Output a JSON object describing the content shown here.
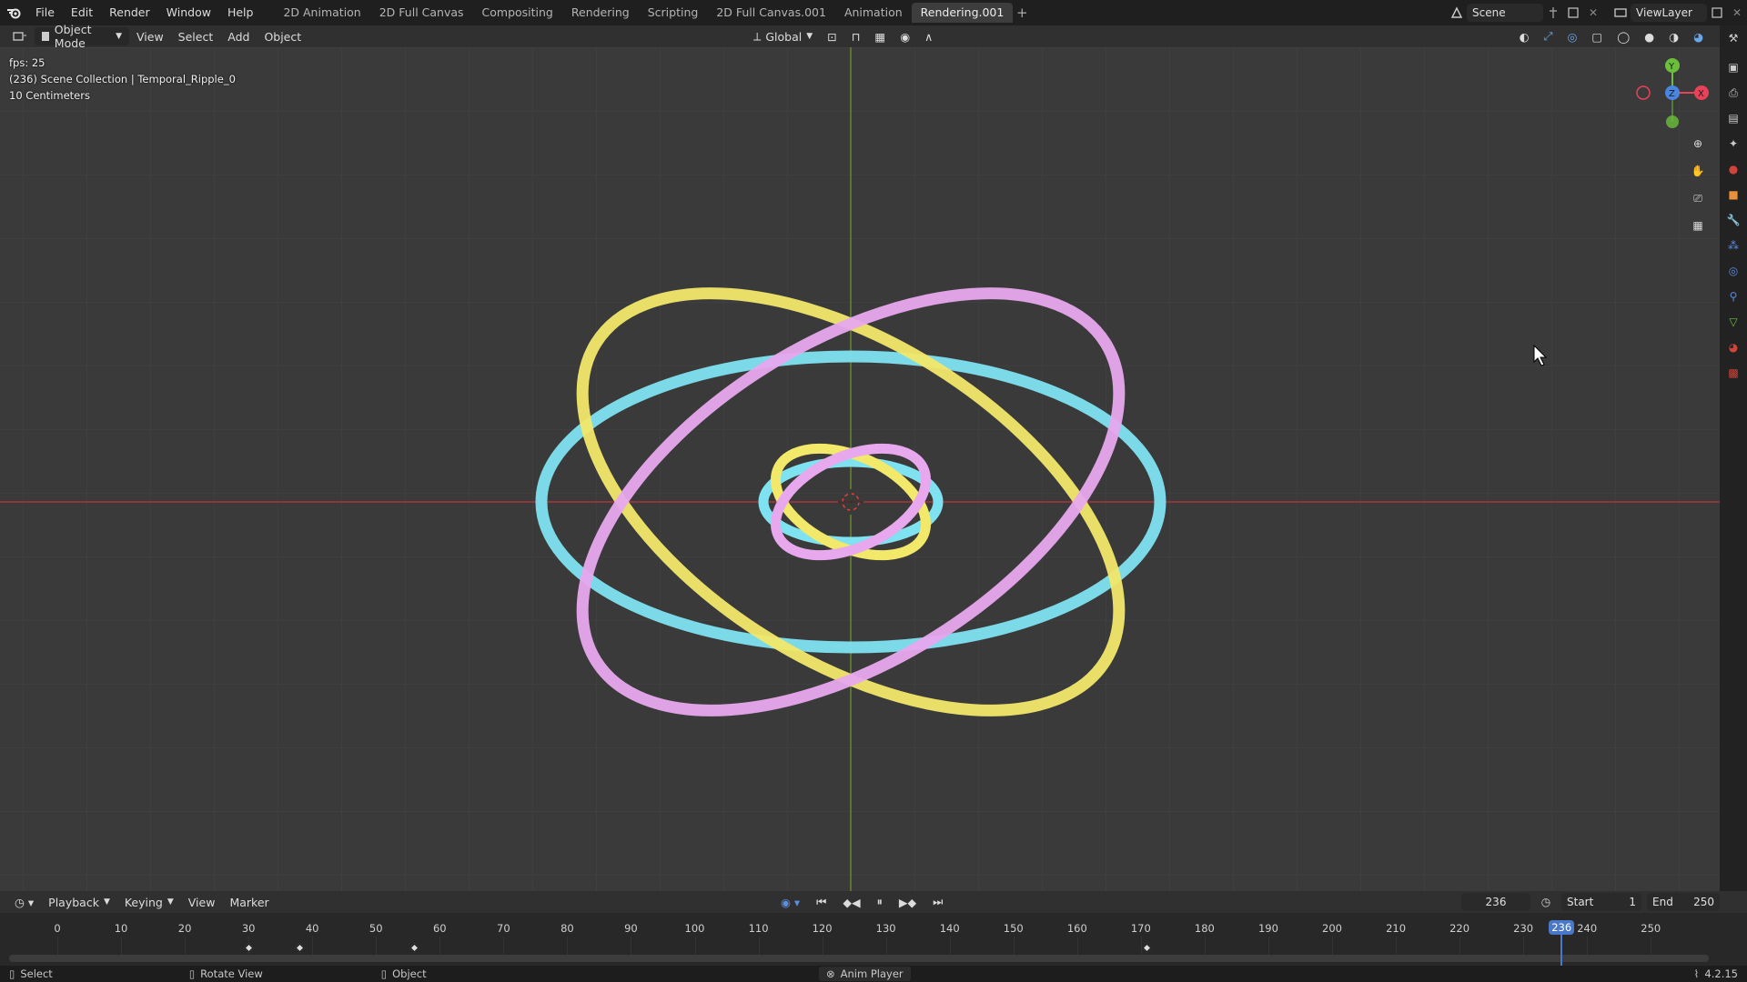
{
  "topbar": {
    "menu": [
      "File",
      "Edit",
      "Render",
      "Window",
      "Help"
    ],
    "tabs": [
      "2D Animation",
      "2D Full Canvas",
      "Compositing",
      "Rendering",
      "Scripting",
      "2D Full Canvas.001",
      "Animation",
      "Rendering.001"
    ],
    "active_tab": "Rendering.001",
    "scene": "Scene",
    "view_layer": "ViewLayer"
  },
  "header": {
    "mode": "Object Mode",
    "menu": [
      "View",
      "Select",
      "Add",
      "Object"
    ],
    "transform": "Global"
  },
  "viewport": {
    "fps": "fps: 25",
    "collection": "(236) Scene Collection | Temporal_Ripple_0",
    "scale": "10 Centimeters",
    "colors": {
      "yellow": "#f2e86a",
      "cyan": "#7fe2f0",
      "pink": "#e7a8ee",
      "axis_x": "#a8343f",
      "axis_y": "#6b8a2b"
    }
  },
  "timeline": {
    "menu": [
      "Playback",
      "Keying",
      "View",
      "Marker"
    ],
    "current_frame": "236",
    "start_label": "Start",
    "start": "1",
    "end_label": "End",
    "end": "250",
    "ticks": [
      "0",
      "10",
      "20",
      "30",
      "40",
      "50",
      "60",
      "70",
      "80",
      "90",
      "100",
      "110",
      "120",
      "130",
      "140",
      "150",
      "160",
      "170",
      "180",
      "190",
      "200",
      "210",
      "220",
      "230",
      "240",
      "250"
    ],
    "keyframes": [
      30,
      38,
      56,
      171
    ]
  },
  "status": {
    "select": "Select",
    "rotate": "Rotate View",
    "object": "Object",
    "anim_player": "Anim Player",
    "version": "4.2.15"
  }
}
